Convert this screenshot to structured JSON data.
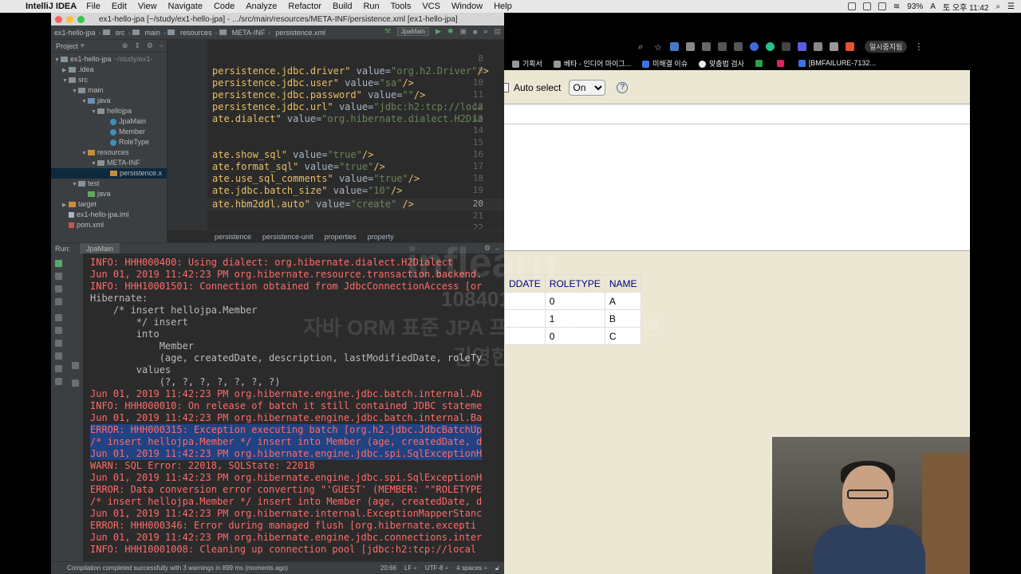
{
  "menubar": {
    "app_name": "IntelliJ IDEA",
    "items": [
      "File",
      "Edit",
      "View",
      "Navigate",
      "Code",
      "Analyze",
      "Refactor",
      "Build",
      "Run",
      "Tools",
      "VCS",
      "Window",
      "Help"
    ],
    "battery": "93%",
    "clock": "토 오후 11:42"
  },
  "ide": {
    "window_title": "ex1-hello-jpa [~/study/ex1-hello-jpa] - .../src/main/resources/META-INF/persistence.xml [ex1-hello-jpa]",
    "breadcrumbs": [
      "ex1-hello-jpa",
      "src",
      "main",
      "resources",
      "META-INF",
      "persistence.xml"
    ],
    "run_config": "JpaMain",
    "project_label": "Project",
    "tree": [
      {
        "label": "ex1-hello-jpa",
        "suffix": "~/study/ex1-"
      },
      {
        "label": ".idea"
      },
      {
        "label": "src"
      },
      {
        "label": "main"
      },
      {
        "label": "java"
      },
      {
        "label": "hellojpa"
      },
      {
        "label": "JpaMain"
      },
      {
        "label": "Member"
      },
      {
        "label": "RoleType"
      },
      {
        "label": "resources"
      },
      {
        "label": "META-INF"
      },
      {
        "label": "persistence.x"
      },
      {
        "label": "test"
      },
      {
        "label": "java"
      },
      {
        "label": "target"
      },
      {
        "label": "ex1-hello-jpa.iml"
      },
      {
        "label": "pom.xml"
      }
    ],
    "line_numbers": [
      "8",
      "9",
      "10",
      "11",
      "12",
      "13",
      "14",
      "15",
      "16",
      "17",
      "18",
      "19",
      "20",
      "21",
      "22"
    ],
    "code_lines": [
      {
        "prop": "persistence.jdbc.driver\"",
        "eq": " value=",
        "val": "\"org.h2.Driver\"",
        "end": "/>"
      },
      {
        "prop": "persistence.jdbc.user\"",
        "eq": " value=",
        "val": "\"sa\"",
        "end": "/>"
      },
      {
        "prop": "persistence.jdbc.password\"",
        "eq": " value=",
        "val": "\"\"",
        "end": "/>"
      },
      {
        "prop": "persistence.jdbc.url\"",
        "eq": " value=",
        "val": "\"jdbc:h2:tcp://loca",
        "end": ""
      },
      {
        "prop": "ate.dialect\"",
        "eq": " value=",
        "val": "\"org.hibernate.dialect.H2Dia",
        "end": ""
      },
      {
        "prop": "",
        "eq": "",
        "val": "",
        "end": ""
      },
      {
        "prop": "",
        "eq": "",
        "val": "",
        "end": ""
      },
      {
        "prop": "ate.show_sql\"",
        "eq": " value=",
        "val": "\"true\"",
        "end": "/>"
      },
      {
        "prop": "ate.format_sql\"",
        "eq": " value=",
        "val": "\"true\"",
        "end": "/>"
      },
      {
        "prop": "ate.use_sql_comments\"",
        "eq": " value=",
        "val": "\"true\"",
        "end": "/>"
      },
      {
        "prop": "ate.jdbc.batch_size\"",
        "eq": " value=",
        "val": "\"10\"",
        "end": "/>"
      },
      {
        "prop": "ate.hbm2ddl.auto\"",
        "eq": " value=",
        "val": "\"create\"",
        "end": " />"
      }
    ],
    "editor_crumbs": [
      "persistence",
      "persistence-unit",
      "properties",
      "property"
    ],
    "run_label": "Run:",
    "run_tab": "JpaMain",
    "console": [
      {
        "t": "INFO: HHH000400: Using dialect: org.hibernate.dialect.H2Dialect",
        "k": "err"
      },
      {
        "t": "Jun 01, 2019 11:42:23 PM org.hibernate.resource.transaction.backend.",
        "k": "err"
      },
      {
        "t": "INFO: HHH10001501: Connection obtained from JdbcConnectionAccess [or",
        "k": "err"
      },
      {
        "t": "Hibernate:",
        "k": "n"
      },
      {
        "t": "    /* insert hellojpa.Member",
        "k": "n"
      },
      {
        "t": "        */ insert",
        "k": "n"
      },
      {
        "t": "        into",
        "k": "n"
      },
      {
        "t": "            Member",
        "k": "n"
      },
      {
        "t": "            (age, createdDate, description, lastModifiedDate, roleTy",
        "k": "n"
      },
      {
        "t": "        values",
        "k": "n"
      },
      {
        "t": "            (?, ?, ?, ?, ?, ?, ?)",
        "k": "n"
      },
      {
        "t": "Jun 01, 2019 11:42:23 PM org.hibernate.engine.jdbc.batch.internal.Ab",
        "k": "err"
      },
      {
        "t": "INFO: HHH000010: On release of batch it still contained JDBC stateme",
        "k": "err"
      },
      {
        "t": "Jun 01, 2019 11:42:23 PM org.hibernate.engine.jdbc.batch.internal.Ba",
        "k": "err"
      },
      {
        "t": "ERROR: HHH000315: Exception executing batch [org.h2.jdbc.JdbcBatchUp",
        "k": "errhl"
      },
      {
        "t": "/* insert hellojpa.Member */ insert into Member (age, createdDate, d",
        "k": "errhl"
      },
      {
        "t": "Jun 01, 2019 11:42:23 PM org.hibernate.engine.jdbc.spi.SqlExceptionH",
        "k": "errhl"
      },
      {
        "t": "WARN: SQL Error: 22018, SQLState: 22018",
        "k": "errhl"
      },
      {
        "t": "Jun 01, 2019 11:42:23 PM org.hibernate.engine.jdbc.spi.SqlExceptionH",
        "k": "err"
      },
      {
        "t": "ERROR: Data conversion error converting \"'GUEST' (MEMBER: \"\"ROLETYPE",
        "k": "err"
      },
      {
        "t": "/* insert hellojpa.Member */ insert into Member (age, createdDate, d",
        "k": "err"
      },
      {
        "t": "Jun 01, 2019 11:42:23 PM org.hibernate.internal.ExceptionMapperStanc",
        "k": "err"
      },
      {
        "t": "ERROR: HHH000346: Error during managed flush [org.hibernate.excepti",
        "k": "err"
      },
      {
        "t": "Jun 01, 2019 11:42:23 PM org.hibernate.engine.jdbc.connections.inter",
        "k": "err"
      },
      {
        "t": "INFO: HHH10001008: Cleaning up connection pool [jdbc:h2:tcp://local",
        "k": "err"
      }
    ],
    "status_msg": "Compilation completed successfully with 3 warnings in 899 ms (moments ago)",
    "status_pos": "20:66",
    "status_lf": "LF ÷",
    "status_enc": "UTF-8 ÷",
    "status_indent": "4 spaces ÷"
  },
  "browser": {
    "bookmarks": [
      "기획서",
      "베타 - 인디어 마이그...",
      "미해결 이슈",
      "맞춤법 검사",
      "",
      "[BMFAILURE-7132..."
    ],
    "profile": "일시중지됨",
    "auto_select_label": "Auto select",
    "auto_select_value": "On",
    "table_headers": [
      "DDATE",
      "ROLETYPE",
      "NAME"
    ],
    "table_rows": [
      [
        "",
        "0",
        "A"
      ],
      [
        "",
        "1",
        "B"
      ],
      [
        "",
        "0",
        "C"
      ]
    ]
  },
  "watermark": {
    "logo": "inflearn",
    "code": "1084018",
    "title": "자바 ORM 표준 JPA 프로그래밍 - 기본편",
    "author": "김영한"
  },
  "colors": {
    "console_error": "#ff6b68",
    "console_highlight": "#214283",
    "browser_bg": "#ece7d3"
  }
}
